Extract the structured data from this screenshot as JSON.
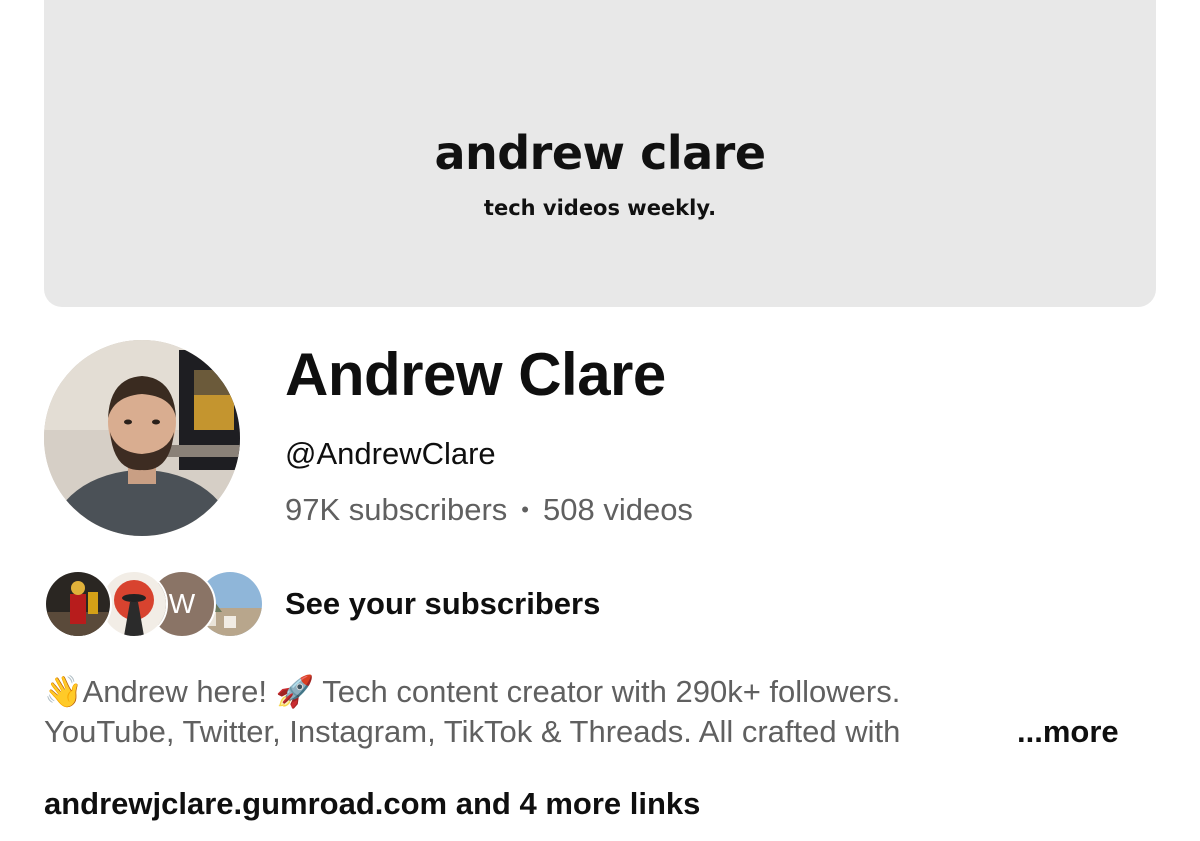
{
  "banner": {
    "title": "andrew clare",
    "tagline": "tech videos weekly."
  },
  "channel": {
    "name": "Andrew Clare",
    "handle": "@AndrewClare",
    "subscribers": "97K subscribers",
    "separator": "•",
    "videos": "508 videos"
  },
  "subscribers_preview": {
    "label": "See your subscribers",
    "avatars": [
      {
        "icon": "sports-avatar"
      },
      {
        "icon": "samurai-avatar"
      },
      {
        "letter": "W"
      },
      {
        "icon": "landscape-avatar"
      }
    ]
  },
  "description": {
    "line1": "👋Andrew here! 🚀 Tech content creator with 290k+ followers.",
    "line2": "YouTube, Twitter, Instagram, TikTok & Threads. All crafted with",
    "more_label": "...more"
  },
  "links": {
    "label": "andrewjclare.gumroad.com and 4 more links"
  },
  "colors": {
    "banner_bg": "#e8e8e8",
    "text_primary": "#0f0f0f",
    "text_secondary": "#606060"
  }
}
